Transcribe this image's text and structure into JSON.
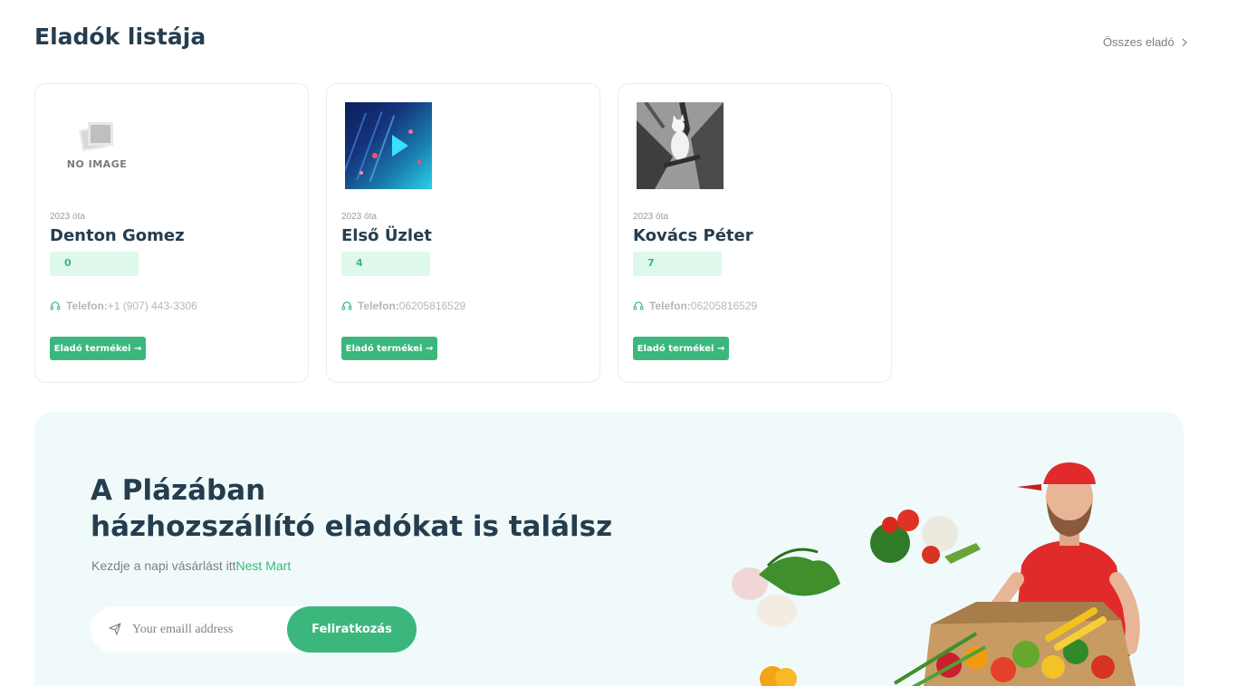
{
  "section": {
    "title": "Eladók listája",
    "all_link": "Összes eladó"
  },
  "vendors": [
    {
      "image": "NO IMAGE",
      "since": "2023 óta",
      "name": "Denton Gomez",
      "count": "0",
      "phone_label": "Telefon:",
      "phone": "+1 (907) 443-3306",
      "button": "Eladó termékei"
    },
    {
      "since": "2023 óta",
      "name": "Első Üzlet",
      "count": "4",
      "phone_label": "Telefon:",
      "phone": "06205816529",
      "button": "Eladó termékei"
    },
    {
      "since": "2023 óta",
      "name": "Kovács Péter",
      "count": "7",
      "phone_label": "Telefon:",
      "phone": "06205816529",
      "button": "Eladó termékei"
    }
  ],
  "banner": {
    "title_line1": "A Plázában",
    "title_line2": "házhozszállító eladókat is találsz",
    "subtitle": "Kezdje a napi vásárlást itt",
    "subtitle_brand": "Nest Mart",
    "email_placeholder": "Your emaill address",
    "subscribe_button": "Feliratkozás"
  },
  "colors": {
    "accent": "#3bb77e",
    "heading": "#253d4e",
    "badge_bg": "#def9ec",
    "banner_bg": "#f0fafa"
  }
}
